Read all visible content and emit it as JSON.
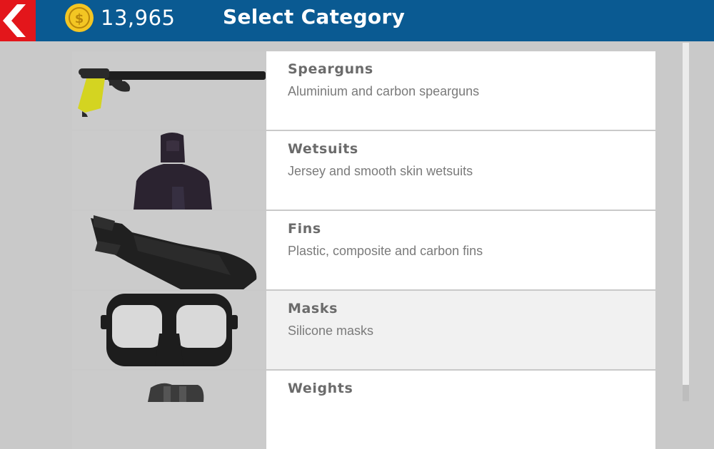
{
  "header": {
    "coins": "13,965",
    "title": "Select Category",
    "coin_symbol": "$",
    "back_icon": "chevron-left-icon",
    "colors": {
      "bar": "#0a5a92",
      "back": "#e3161b",
      "coin": "#f3c623"
    }
  },
  "categories": [
    {
      "name": "Spearguns",
      "description": "Aluminium and carbon spearguns",
      "icon": "speargun-icon"
    },
    {
      "name": "Wetsuits",
      "description": "Jersey and smooth skin wetsuits",
      "icon": "wetsuit-icon"
    },
    {
      "name": "Fins",
      "description": "Plastic, composite and carbon fins",
      "icon": "fins-icon"
    },
    {
      "name": "Masks",
      "description": "Silicone masks",
      "icon": "mask-icon",
      "selected": true
    },
    {
      "name": "Weights",
      "description": "",
      "icon": "weights-icon"
    }
  ]
}
